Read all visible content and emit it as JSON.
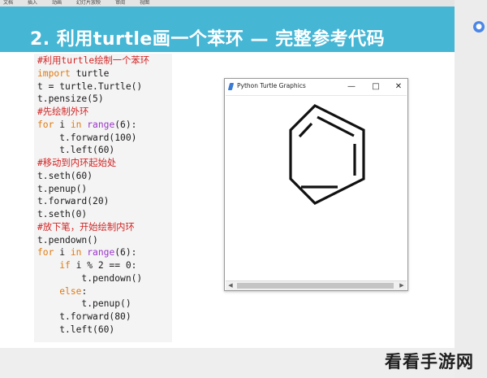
{
  "top_strip": [
    "文档",
    "插入",
    "动画",
    "幻灯片放映",
    "审阅",
    "视图"
  ],
  "slide": {
    "title": "2. 利用turtle画一个苯环 — 完整参考代码",
    "code_lines": [
      {
        "text": "#利用turtle绘制一个苯环",
        "kind": "comment"
      },
      {
        "text": "import turtle",
        "kind": "import"
      },
      {
        "text": "t = turtle.Turtle()",
        "kind": "plain"
      },
      {
        "text": "t.pensize(5)",
        "kind": "plain"
      },
      {
        "text": "#先绘制外环",
        "kind": "comment"
      },
      {
        "text": "for i in range(6):",
        "kind": "for"
      },
      {
        "text": "    t.forward(100)",
        "kind": "plain"
      },
      {
        "text": "    t.left(60)",
        "kind": "plain"
      },
      {
        "text": "#移动到内环起始处",
        "kind": "comment"
      },
      {
        "text": "t.seth(60)",
        "kind": "plain"
      },
      {
        "text": "t.penup()",
        "kind": "plain"
      },
      {
        "text": "t.forward(20)",
        "kind": "plain"
      },
      {
        "text": "t.seth(0)",
        "kind": "plain"
      },
      {
        "text": "#放下笔，开始绘制内环",
        "kind": "comment"
      },
      {
        "text": "t.pendown()",
        "kind": "plain"
      },
      {
        "text": "for i in range(6):",
        "kind": "for"
      },
      {
        "text": "    if i % 2 == 0:",
        "kind": "if"
      },
      {
        "text": "        t.pendown()",
        "kind": "plain"
      },
      {
        "text": "    else:",
        "kind": "else"
      },
      {
        "text": "        t.penup()",
        "kind": "plain"
      },
      {
        "text": "    t.forward(80)",
        "kind": "plain"
      },
      {
        "text": "    t.left(60)",
        "kind": "plain"
      }
    ]
  },
  "turtle_window": {
    "title": "Python Turtle Graphics",
    "minimize": "—",
    "maximize": "□",
    "close": "✕",
    "drawing": "benzene-ring"
  },
  "watermark": "看看手游网",
  "colors": {
    "banner": "#46b6d5",
    "comment": "#d32222",
    "keyword": "#e07a10",
    "builtin": "#9a36c9"
  }
}
